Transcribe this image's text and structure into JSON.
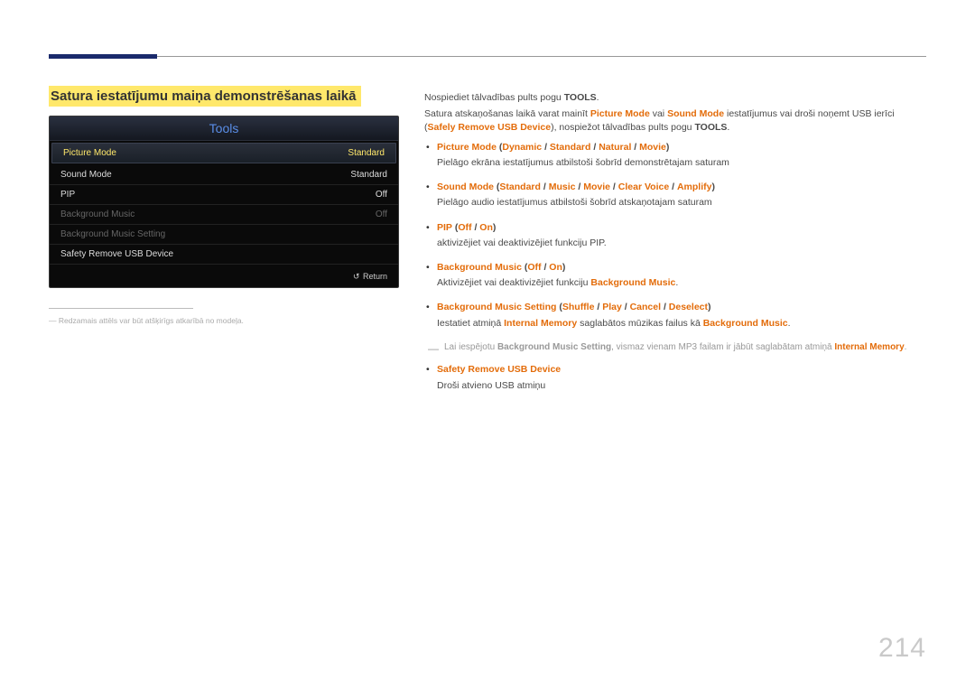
{
  "pageNumber": "214",
  "sectionTitle": "Satura iestatījumu maiņa demonstrēšanas laikā",
  "tools": {
    "title": "Tools",
    "rows": [
      {
        "label": "Picture Mode",
        "value": "Standard",
        "state": "selected"
      },
      {
        "label": "Sound Mode",
        "value": "Standard",
        "state": "normal"
      },
      {
        "label": "PIP",
        "value": "Off",
        "state": "normal"
      },
      {
        "label": "Background Music",
        "value": "Off",
        "state": "dim"
      },
      {
        "label": "Background Music Setting",
        "value": "",
        "state": "dim"
      },
      {
        "label": "Safety Remove USB Device",
        "value": "",
        "state": "normal"
      }
    ],
    "returnLabel": "Return"
  },
  "footnote": "Redzamais attēls var būt atšķirīgs atkarībā no modeļa.",
  "intro": {
    "line1_pre": "Nospiediet tālvadības pults pogu ",
    "line1_bold": "TOOLS",
    "line1_post": ".",
    "line2_a": "Satura atskaņošanas laikā varat mainīt ",
    "picMode": "Picture Mode",
    "or": " vai ",
    "sndMode": "Sound Mode",
    "line2_b": " iestatījumus vai droši noņemt USB ierīci (",
    "safely": "Safely Remove USB Device",
    "line2_c": "), nospiežot tālvadības pults pogu ",
    "tools2": "TOOLS",
    "line2_d": "."
  },
  "items": {
    "pic": {
      "title_a": "Picture Mode",
      "p1": "Dynamic",
      "p2": "Standard",
      "p3": "Natural",
      "p4": "Movie",
      "desc": "Pielāgo ekrāna iestatījumus atbilstoši šobrīd demonstrētajam saturam"
    },
    "snd": {
      "title_a": "Sound Mode",
      "p1": "Standard",
      "p2": "Music",
      "p3": "Movie",
      "p4": "Clear Voice",
      "p5": "Amplify",
      "desc": "Pielāgo audio iestatījumus atbilstoši šobrīd atskaņotajam saturam"
    },
    "pip": {
      "title_a": "PIP",
      "p1": "Off",
      "p2": "On",
      "desc": "aktivizējiet vai deaktivizējiet funkciju PIP."
    },
    "bgm": {
      "title_a": "Background Music",
      "p1": "Off",
      "p2": "On",
      "desc_a": "Aktivizējiet vai deaktivizējiet funkciju ",
      "desc_b": "Background Music",
      "desc_c": "."
    },
    "bgms": {
      "title_a": "Background Music Setting",
      "p1": "Shuffle",
      "p2": "Play",
      "p3": "Cancel",
      "p4": "Deselect",
      "desc_a": "Iestatiet atmiņā ",
      "desc_mem": "Internal Memory",
      "desc_b": " saglabātos mūzikas failus kā ",
      "desc_bgm": "Background Music",
      "desc_c": "."
    },
    "note": {
      "a": "Lai iespējotu ",
      "b": "Background Music Setting",
      "c": ", vismaz vienam MP3 failam ir jābūt saglabātam atmiņā ",
      "d": "Internal Memory",
      "e": "."
    },
    "usb": {
      "title": "Safety Remove USB Device",
      "desc": "Droši atvieno USB atmiņu"
    }
  }
}
